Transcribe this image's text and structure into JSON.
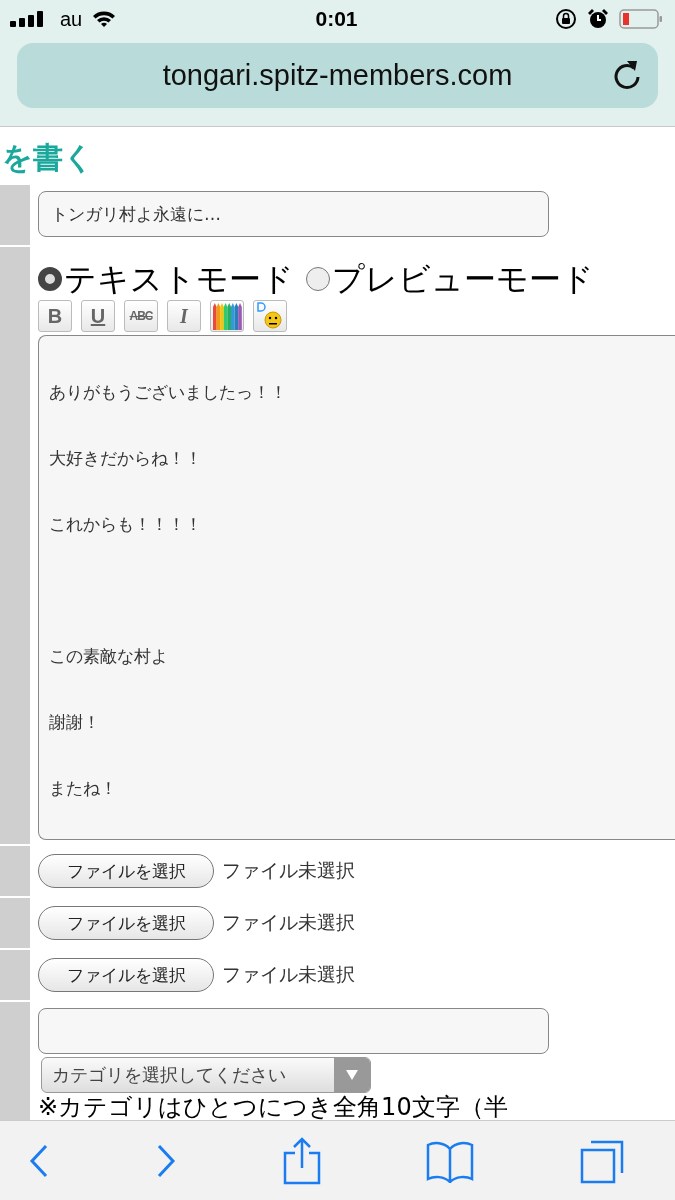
{
  "status_bar": {
    "carrier": "au",
    "time": "0:01"
  },
  "address_bar": {
    "url": "tongari.spitz-members.com"
  },
  "heading": "を書く",
  "title_field": {
    "value": "トンガリ村よ永遠に…"
  },
  "modes": [
    {
      "label": "テキストモード",
      "selected": true
    },
    {
      "label": "プレビューモード",
      "selected": false
    }
  ],
  "format_buttons": [
    {
      "kind": "bold",
      "label": "B"
    },
    {
      "kind": "underline",
      "label": "U"
    },
    {
      "kind": "strike",
      "label": "ABC"
    },
    {
      "kind": "italic",
      "label": "I"
    },
    {
      "kind": "color"
    },
    {
      "kind": "emoji"
    }
  ],
  "body_lines": [
    {
      "kind": "line",
      "text": "ありがもうございましたっ！！"
    },
    {
      "kind": "line",
      "text": "大好きだからね！！"
    },
    {
      "kind": "line",
      "text": "これからも！！！！"
    },
    {
      "kind": "paragraph",
      "text": "この素敵な村よ"
    },
    {
      "kind": "line",
      "text": "謝謝！"
    },
    {
      "kind": "line",
      "text": "またね！"
    }
  ],
  "file_inputs": [
    {
      "button": "ファイルを選択",
      "status": "ファイル未選択"
    },
    {
      "button": "ファイルを選択",
      "status": "ファイル未選択"
    },
    {
      "button": "ファイルを選択",
      "status": "ファイル未選択"
    }
  ],
  "category_select": {
    "value": "カテゴリを選択してください"
  },
  "category_note": "※カテゴリはひとつにつき全角10文字（半"
}
